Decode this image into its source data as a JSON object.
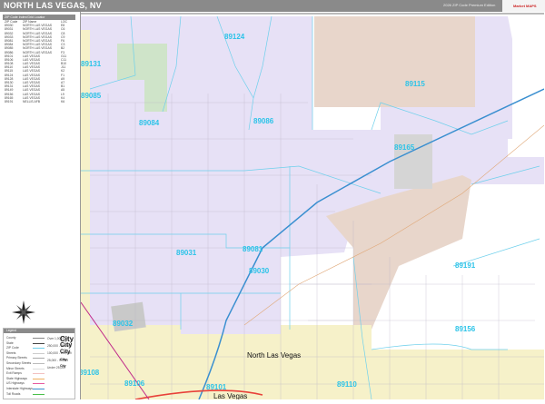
{
  "header": {
    "title": "NORTH LAS VEGAS, NV",
    "edition": "2026 ZIP Code Premium Edition",
    "brand": "Market MAPS"
  },
  "index": {
    "title": "ZIP Code Index/Grid Locator",
    "columns": [
      "ZIP Code",
      "ZIP Name",
      "LOC"
    ],
    "rows": [
      [
        "89030",
        "NORTH LAS VEGAS",
        "E8"
      ],
      [
        "89031",
        "NORTH LAS VEGAS",
        "C6"
      ],
      [
        "89032",
        "NORTH LAS VEGAS",
        "C8"
      ],
      [
        "89033",
        "NORTH LAS VEGAS",
        "C9"
      ],
      [
        "89081",
        "NORTH LAS VEGAS",
        "F6"
      ],
      [
        "89084",
        "NORTH LAS VEGAS",
        "C3"
      ],
      [
        "89085",
        "NORTH LAS VEGAS",
        "B2"
      ],
      [
        "89086",
        "NORTH LAS VEGAS",
        "F3"
      ],
      [
        "89101",
        "LAS VEGAS",
        "G11"
      ],
      [
        "89106",
        "LAS VEGAS",
        "C11"
      ],
      [
        "89108",
        "LAS VEGAS",
        "B10"
      ],
      [
        "89110",
        "LAS VEGAS",
        "J11"
      ],
      [
        "89115",
        "LAS VEGAS",
        "K2"
      ],
      [
        "89124",
        "LAS VEGAS",
        "F1"
      ],
      [
        "89128",
        "LAS VEGAS",
        "A9"
      ],
      [
        "89130",
        "LAS VEGAS",
        "A7"
      ],
      [
        "89131",
        "LAS VEGAS",
        "B1"
      ],
      [
        "89149",
        "LAS VEGAS",
        "A5"
      ],
      [
        "89156",
        "LAS VEGAS",
        "L9"
      ],
      [
        "89165",
        "LAS VEGAS",
        "K4"
      ],
      [
        "89191",
        "NELLIS AFB",
        "K6"
      ]
    ]
  },
  "legend": {
    "title": "Legend",
    "items": [
      "County",
      "State",
      "ZIP Code",
      "Streets",
      "Primary Streets",
      "Secondary Streets",
      "Minor Streets",
      "Exit Ramps",
      "State Highways",
      "US Highways",
      "Interstate Highways",
      "Toll Roads"
    ],
    "cities": [
      {
        "pop": "Over 1,000,000",
        "word": "City"
      },
      {
        "pop": "250,000 - 999,999",
        "word": "City"
      },
      {
        "pop": "100,000 - 249,999",
        "word": "City"
      },
      {
        "pop": "25,000 - 99,999",
        "word": "City"
      },
      {
        "pop": "Under 25,000",
        "word": "City"
      }
    ]
  },
  "map": {
    "zip_labels": [
      "89124",
      "89131",
      "89085",
      "89084",
      "89086",
      "89115",
      "89165",
      "89031",
      "89081",
      "89030",
      "89032",
      "89191",
      "89156",
      "89108",
      "89106",
      "89101",
      "89110"
    ],
    "city_labels": [
      "North Las Vegas",
      "Las Vegas"
    ],
    "colors": {
      "north_las_vegas": "#e7e1f6",
      "las_vegas": "#f6f1c9",
      "nellis": "#e8d6cb",
      "park": "#cfe4c9",
      "zip_label": "#2cc3e8",
      "interstate": "#3a8fd0"
    }
  }
}
